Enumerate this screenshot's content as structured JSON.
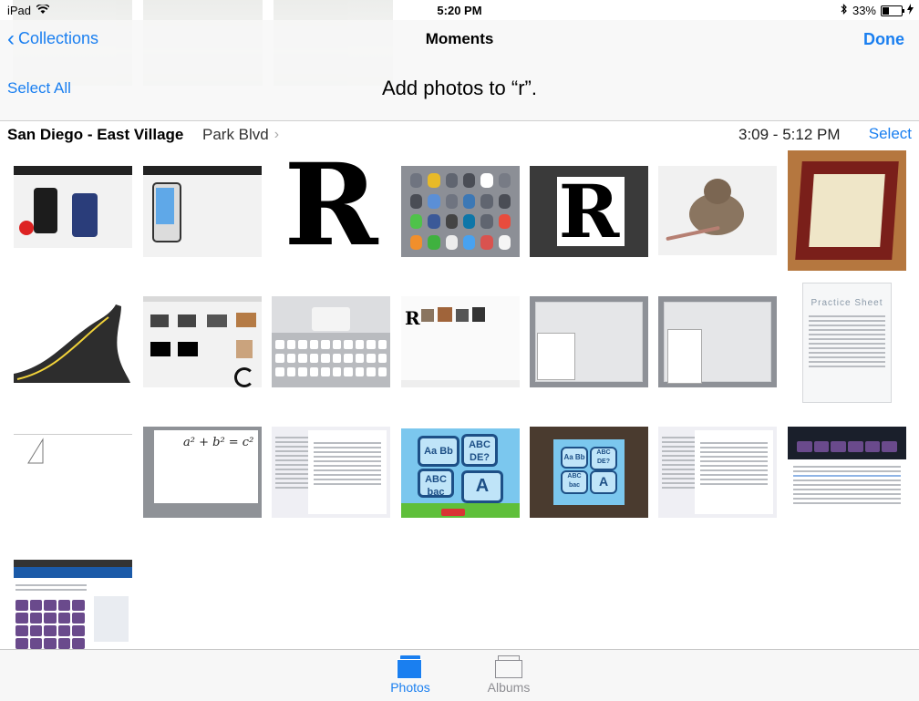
{
  "status_bar": {
    "device": "iPad",
    "time": "5:20 PM",
    "battery": "33%",
    "battery_level": 0.33
  },
  "nav": {
    "back_label": "Collections",
    "title": "Moments",
    "done_label": "Done",
    "select_all_label": "Select All",
    "prompt": "Add photos to “r”."
  },
  "moment": {
    "location": "San Diego - East Village",
    "sublocation": "Park Blvd",
    "time_range": "3:09 - 5:12 PM",
    "select_label": "Select"
  },
  "photos": {
    "r_letter": "R",
    "formula": "a² + b² = c²",
    "practice_sheet": "Practice Sheet",
    "quiz_labels": [
      "Aa Bb",
      "ABC DE?",
      "ABC bac",
      "A"
    ]
  },
  "tabs": [
    {
      "label": "Photos",
      "icon": "photos-stack-icon",
      "selected": true
    },
    {
      "label": "Albums",
      "icon": "albums-icon",
      "selected": false
    }
  ],
  "colors": {
    "accent": "#1a7ff0",
    "inactive": "#8e8e93"
  }
}
